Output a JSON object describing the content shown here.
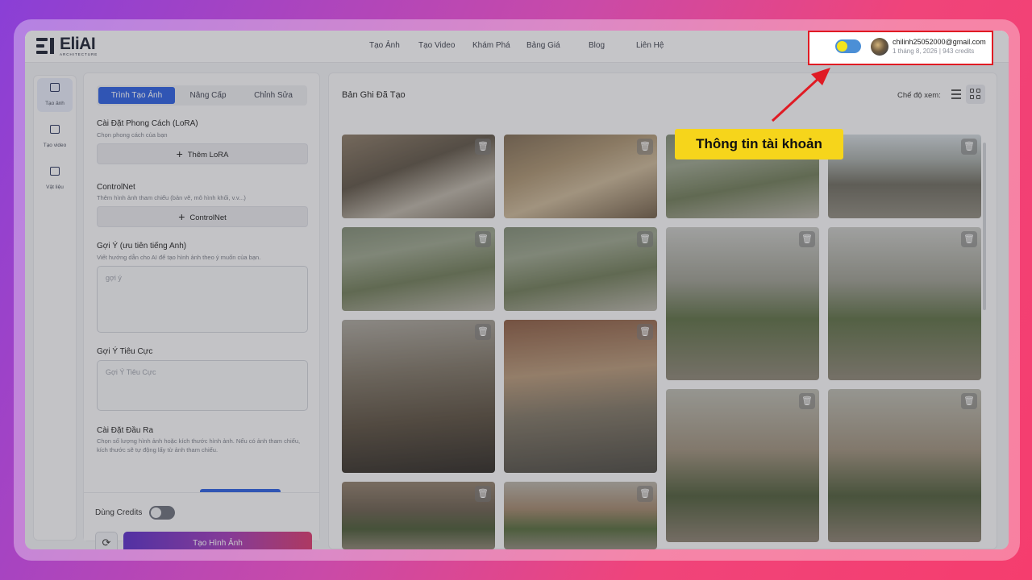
{
  "app": {
    "logo_name": "EliAI",
    "logo_sub": "ARCHITECTURE"
  },
  "nav": {
    "items": [
      "Tạo Ảnh",
      "Tạo Video",
      "Khám Phá",
      "Bảng Giá",
      "Blog",
      "Liên Hệ"
    ]
  },
  "account": {
    "email": "chilinh25052000@gmail.com",
    "meta": "1 tháng 8, 2026 | 943 credits"
  },
  "sidebar": {
    "items": [
      {
        "label": "Tạo ảnh",
        "icon": "image-icon"
      },
      {
        "label": "Tạo video",
        "icon": "video-icon"
      },
      {
        "label": "Vật liệu",
        "icon": "materials-icon"
      }
    ]
  },
  "panel": {
    "tabs": [
      "Trình Tạo Ảnh",
      "Nâng Cấp",
      "Chỉnh Sửa"
    ],
    "lora_title": "Cài Đặt Phong Cách (LoRA)",
    "lora_desc": "Chọn phong cách của bạn",
    "lora_button": "Thêm LoRA",
    "controlnet_title": "ControlNet",
    "controlnet_desc": "Thêm hình ảnh tham chiếu (bản vẽ, mô hình khối, v.v...)",
    "controlnet_button": "ControlNet",
    "prompt_title": "Gợi Ý (ưu tiên tiếng Anh)",
    "prompt_desc": "Viết hướng dẫn cho AI để tạo hình ảnh theo ý muốn của bạn.",
    "prompt_placeholder": "gợi ý",
    "negative_title": "Gợi Ý Tiêu Cực",
    "negative_placeholder": "Gợi Ý Tiêu Cực",
    "output_title": "Cài Đặt Đầu Ra",
    "output_desc": "Chọn số lượng hình ảnh hoặc kích thước hình ảnh. Nếu có ảnh tham chiếu, kích thước sẽ tự động lấy từ ảnh tham chiếu.",
    "credits_label": "Dùng Credits",
    "generate_button": "Tạo Hình Ảnh"
  },
  "gallery": {
    "title": "Bản Ghi Đã Tạo",
    "view_label": "Chế độ xem:"
  },
  "annotation": {
    "callout": "Thông tin tài khoản",
    "color_callout": "#f6d51b",
    "color_arrow": "#e01b24"
  }
}
